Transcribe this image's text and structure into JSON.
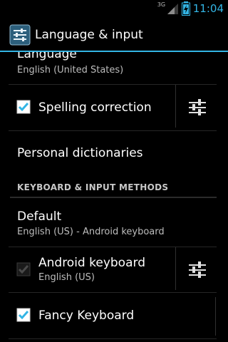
{
  "status_bar": {
    "network": "3G",
    "time": "11:04"
  },
  "action_bar": {
    "title": "Language & input"
  },
  "language": {
    "title": "Language",
    "summary": "English (United States)"
  },
  "spelling": {
    "title": "Spelling correction",
    "checked": true
  },
  "personal_dictionaries": {
    "title": "Personal dictionaries"
  },
  "keyboard_section": {
    "header": "KEYBOARD & INPUT METHODS"
  },
  "default_ime": {
    "title": "Default",
    "summary": "English (US) - Android keyboard"
  },
  "android_keyboard": {
    "title": "Android keyboard",
    "summary": "English (US)",
    "checked": true,
    "enabled": false
  },
  "fancy_keyboard": {
    "title": "Fancy Keyboard",
    "checked": true
  },
  "colors": {
    "accent": "#33b5e5",
    "background": "#000000"
  }
}
